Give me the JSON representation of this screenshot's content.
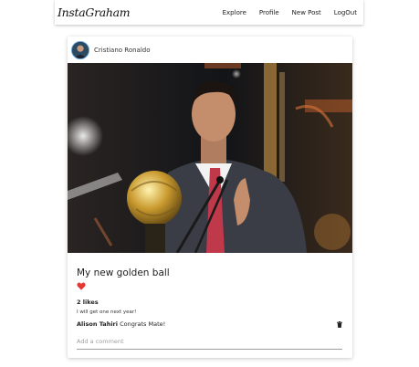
{
  "navbar": {
    "brand": "InstaGraham",
    "links": [
      "Explore",
      "Profile",
      "New Post",
      "LogOut"
    ]
  },
  "post": {
    "author": "Cristiano Ronaldo",
    "title": "My new golden ball",
    "likes_text": "2 likes",
    "caption": "I will get one next year!",
    "comments": [
      {
        "author": "Alison Tahiri",
        "text": "Congrats Mate!"
      }
    ],
    "comment_placeholder": "Add a comment"
  },
  "colors": {
    "heart": "#e53935",
    "avatar_border": "#6aa7d9"
  },
  "icons": {
    "like": "heart-icon",
    "delete": "trash-icon"
  }
}
